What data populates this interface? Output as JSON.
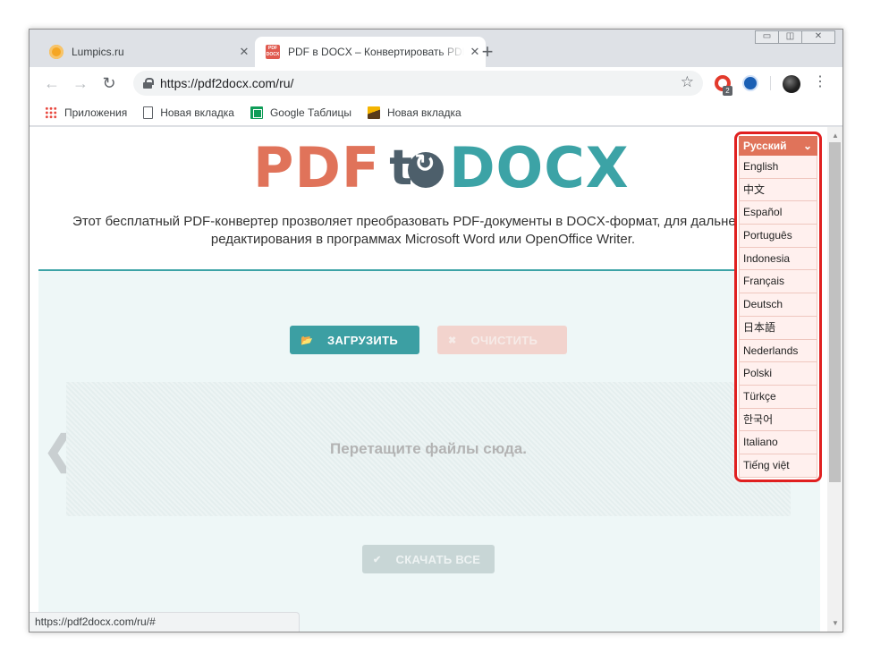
{
  "browser": {
    "tabs": [
      {
        "title": "Lumpics.ru",
        "close": "✕"
      },
      {
        "title": "PDF в DOCX – Конвертировать PDF в DOCX",
        "favicon_text": "PDF DOCX",
        "close": "✕"
      }
    ],
    "new_tab": "+",
    "window_controls": {
      "minimize": "▭",
      "maximize": "◫",
      "close": "✕"
    },
    "nav": {
      "back": "←",
      "forward": "→",
      "reload": "↻"
    },
    "url": "https://pdf2docx.com/ru/",
    "star": "☆",
    "extension_badge": "2",
    "menu": "⋮",
    "bookmarks": [
      {
        "icon": "apps-icon",
        "label": "Приложения"
      },
      {
        "icon": "page-icon",
        "label": "Новая вкладка"
      },
      {
        "icon": "sheets-icon",
        "label": "Google Таблицы"
      },
      {
        "icon": "photo-icon",
        "label": "Новая вкладка"
      }
    ],
    "status_url": "https://pdf2docx.com/ru/#"
  },
  "page": {
    "logo": {
      "pdf": "PDF",
      "to": "t",
      "docx": "DOCX"
    },
    "intro": "Этот бесплатный PDF-конвертер прозволяет преобразовать PDF-документы в DOCX-формат, для дальнейшего редактирования в программах Microsoft Word или OpenOffice Writer.",
    "upload_label": "ЗАГРУЗИТЬ",
    "upload_icon": "📂",
    "clear_label": "ОЧИСТИТЬ",
    "clear_icon": "✖",
    "dropzone_text": "Перетащите файлы сюда.",
    "prev_arrow": "❮",
    "download_label": "СКАЧАТЬ ВСЕ",
    "download_icon": "✔"
  },
  "language": {
    "selected": "Русский",
    "caret": "⌄",
    "options": [
      "English",
      "中文",
      "Español",
      "Português",
      "Indonesia",
      "Français",
      "Deutsch",
      "日本語",
      "Nederlands",
      "Polski",
      "Türkçe",
      "한국어",
      "Italiano",
      "Tiếng việt"
    ]
  },
  "colors": {
    "accent_teal": "#3ca3a6",
    "accent_coral": "#e0735a",
    "highlight_red": "#e02020"
  }
}
